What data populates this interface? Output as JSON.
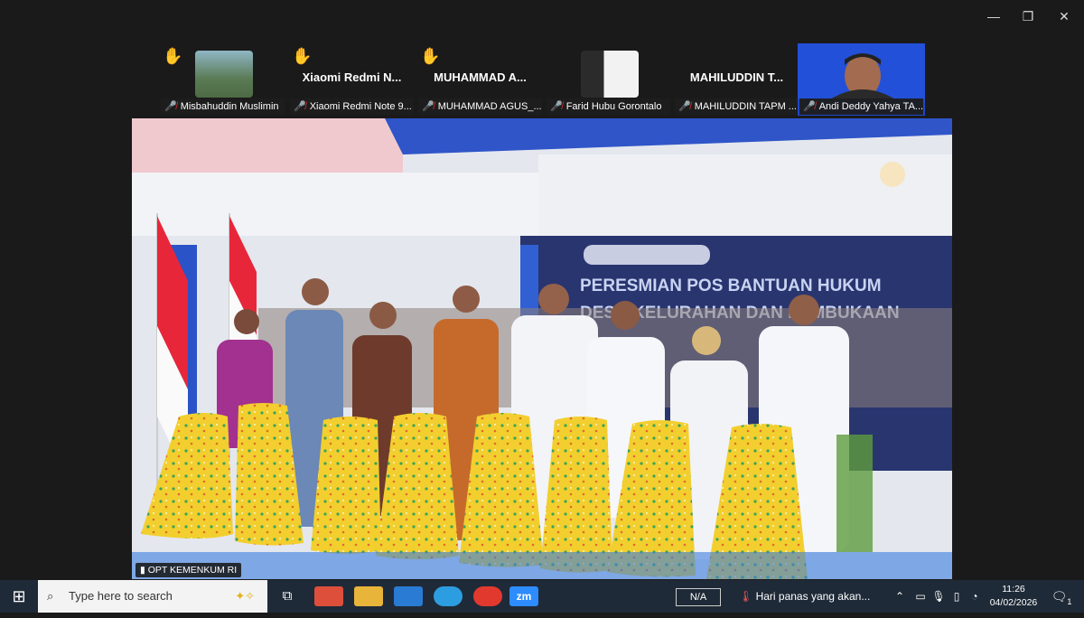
{
  "window": {
    "minimize": "—",
    "restore": "❐",
    "close": "✕"
  },
  "participants": [
    {
      "id": "p1",
      "display_name": "",
      "bar_label": "Misbahuddin Muslimin",
      "hand": "✋",
      "has_video": true
    },
    {
      "id": "p2",
      "display_name": "Xiaomi Redmi N...",
      "bar_label": "Xiaomi Redmi Note 9...",
      "hand": "✋",
      "has_video": false
    },
    {
      "id": "p3",
      "display_name": "MUHAMMAD A...",
      "bar_label": "MUHAMMAD AGUS_...",
      "hand": "✋",
      "has_video": false
    },
    {
      "id": "p4",
      "display_name": "",
      "bar_label": "Farid Hubu Gorontalo",
      "hand": "",
      "has_video": true
    },
    {
      "id": "p5",
      "display_name": "MAHILUDDIN T...",
      "bar_label": "MAHILUDDIN TAPM ...",
      "hand": "",
      "has_video": false
    },
    {
      "id": "p6",
      "display_name": "",
      "bar_label": "Andi Deddy Yahya TA...",
      "hand": "",
      "has_video": true
    }
  ],
  "main_video": {
    "source_label": "OPT KEMENKUM RI",
    "banner_line1": "PERESMIAN POS BANTUAN HUKUM",
    "banner_line2": "DESA/KELURAHAN DAN PEMBUKAAN"
  },
  "taskbar": {
    "search_placeholder": "Type here to search",
    "zoom_label": "zm",
    "na_label": "N/A",
    "weather_text": "Hari panas yang akan...",
    "time": "11:26",
    "date": "04/02/2026",
    "notification_count": "1"
  },
  "colors": {
    "accent": "#2d8cff",
    "muted_mic": "#e0322f",
    "taskbar": "#1f2a38"
  }
}
